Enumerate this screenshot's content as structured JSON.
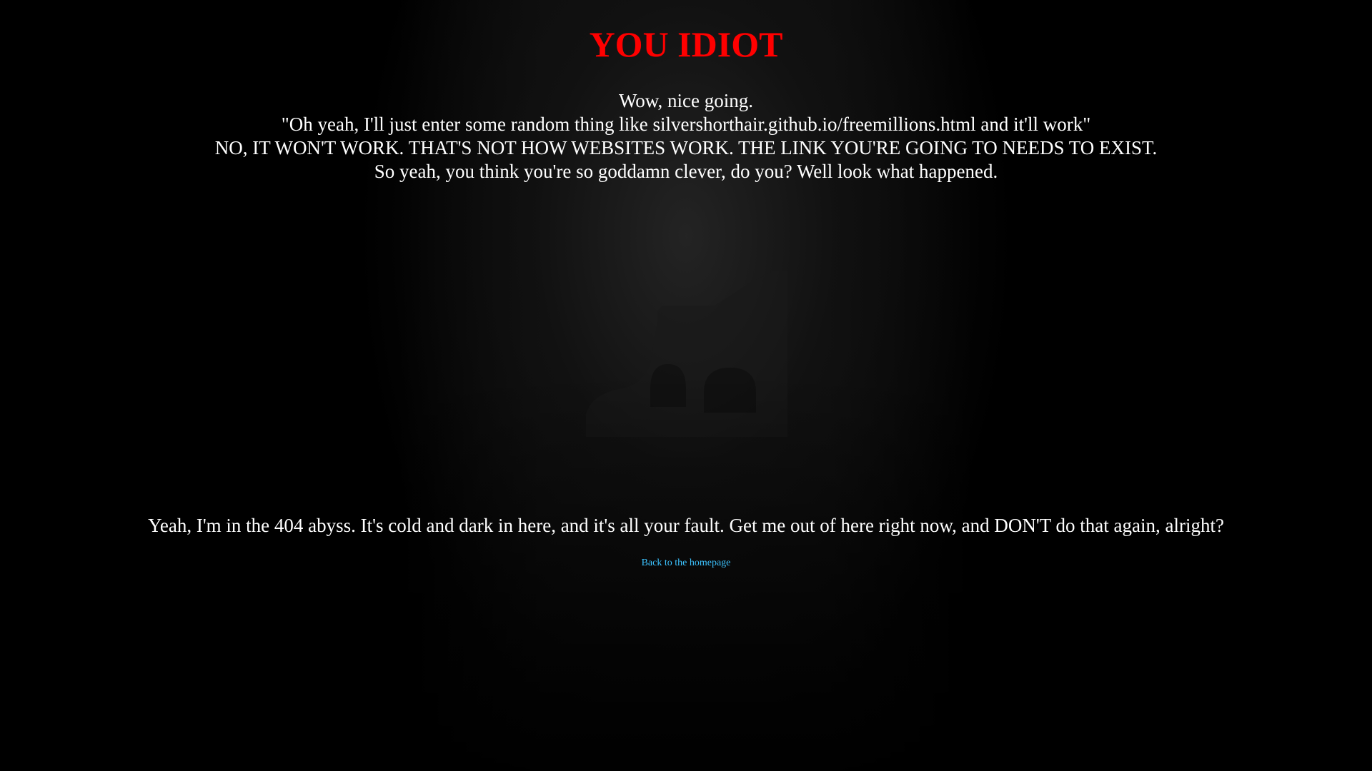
{
  "page": {
    "title": "YOU IDIOT",
    "title_color": "#ff0000",
    "background_color": "#000000",
    "text_color": "#ffffff"
  },
  "message": {
    "lines": [
      "Wow, nice going.",
      "\"Oh yeah, I'll just enter some random thing like silvershorthair.github.io/freemillions.html and it'll work\"",
      "NO, IT WON'T WORK. THAT'S NOT HOW WEBSITES WORK. THE LINK YOU'RE GOING TO NEEDS TO EXIST.",
      "So yeah, you think you're so goddamn clever, do you? Well look what happened."
    ]
  },
  "figure": {
    "icon": "shadowy-cat-silhouette-icon"
  },
  "abyss": {
    "text": "Yeah, I'm in the 404 abyss. It's cold and dark in here, and it's all your fault. Get me out of here right now, and DON'T do that again, alright?"
  },
  "link": {
    "label": "Back to the homepage",
    "color": "#3cc3ff"
  }
}
